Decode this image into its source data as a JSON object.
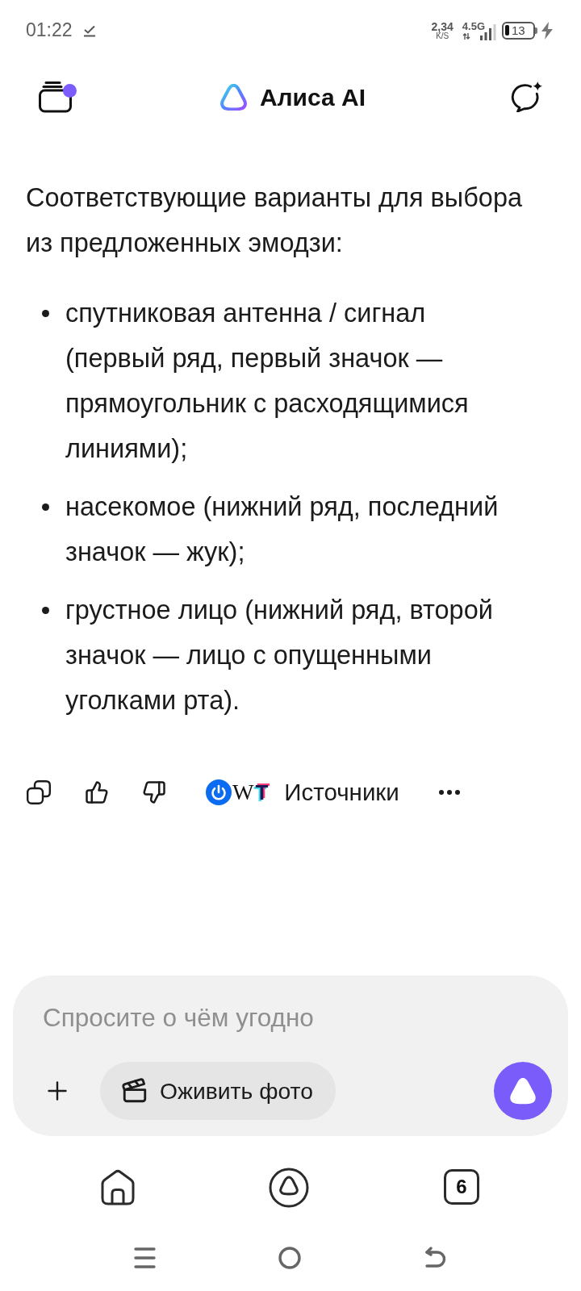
{
  "status_bar": {
    "time": "01:22",
    "speed": "2,34",
    "speed_unit": "K/S",
    "network": "4.5G",
    "battery": "13"
  },
  "header": {
    "title": "Алиса AI",
    "unread": true
  },
  "message": {
    "intro": "Соответствующие варианты для выбора из предложенных эмодзи:",
    "items": [
      "спутниковая антенна / сигнал (первый ряд, первый значок — прямоугольник с расходящимися линиями);",
      "насекомое (нижний ряд, последний значок — жук);",
      "грустное лицо (нижний ряд, второй значок — лицо с опущенными уголками рта)."
    ]
  },
  "actions": {
    "sources": [
      {
        "kind": "power"
      },
      {
        "kind": "serif",
        "letter": "W"
      },
      {
        "kind": "glitch",
        "letter": "T"
      }
    ],
    "sources_label": "Источники"
  },
  "composer": {
    "placeholder": "Спросите о чём угодно",
    "chip": "Оживить фото"
  },
  "bottom_nav": {
    "tabs_count": "6"
  }
}
